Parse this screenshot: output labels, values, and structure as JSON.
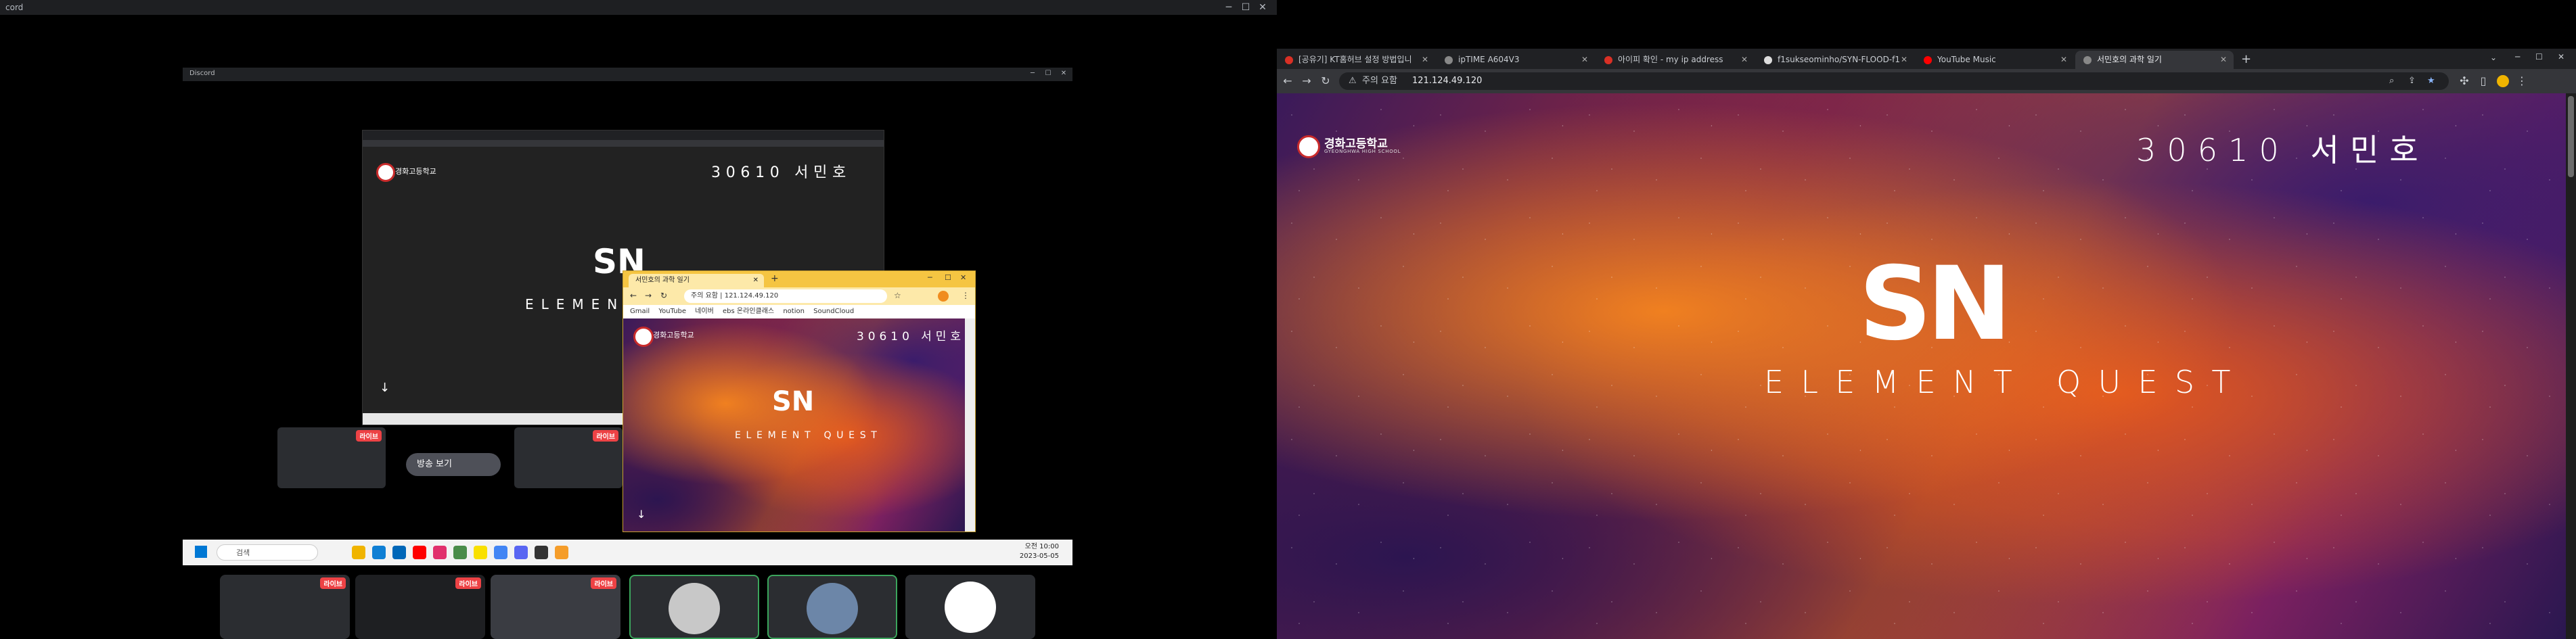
{
  "left": {
    "discord_title": "cord",
    "inner_window_title": "Discord",
    "watch_stream_label": "방송 보기",
    "live_badge": "라이브",
    "popup": {
      "tab_title": "서민호의 과학 일기",
      "address": "주의 요함 | 121.124.49.120",
      "bookmarks": [
        "Gmail",
        "YouTube",
        "네이버",
        "ebs 온라인클래스",
        "notion",
        "SoundCloud"
      ]
    },
    "stream_page": {
      "school_name": "경화고등학교",
      "student": "30610 서민호",
      "title": "ELEMENT QUEST",
      "logo": "SN"
    },
    "taskbar": {
      "search_placeholder": "검색",
      "time": "오전 10:00",
      "date": "2023-05-05"
    }
  },
  "right": {
    "tabs": [
      {
        "label": "[공유기] KT홈허브 설정 방법입니",
        "active": false
      },
      {
        "label": "ipTIME A604V3",
        "active": false
      },
      {
        "label": "아이피 확인 - my ip address",
        "active": false
      },
      {
        "label": "f1sukseominho/SYN-FLOOD-f1",
        "active": false
      },
      {
        "label": "YouTube Music",
        "active": false
      },
      {
        "label": "서민호의 과학 일기",
        "active": true
      }
    ],
    "security_label": "주의 요함",
    "url": "121.124.49.120",
    "page": {
      "school_name": "경화고등학교",
      "school_name_en": "GYEONGHWA HIGH SCHOOL",
      "student": "30610 서민호",
      "logo": "SN",
      "title": "ELEMENT QUEST"
    }
  },
  "colors": {
    "discord_bg": "#000000",
    "chrome_tabstrip": "#202124",
    "chrome_toolbar": "#35363a",
    "popup_yellow": "#f5c542",
    "live_red": "#ed4245",
    "speaking_green": "#3ba55c"
  }
}
